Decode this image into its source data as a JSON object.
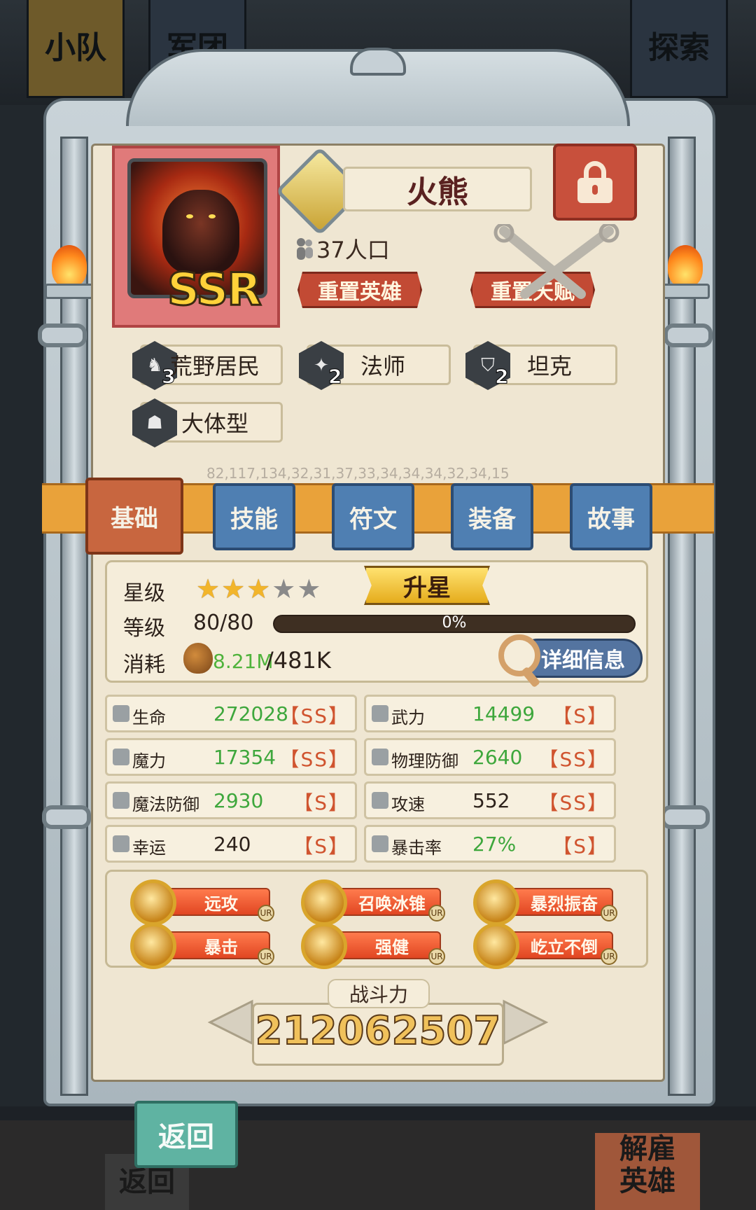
{
  "top_tabs": [
    "小队",
    "军团",
    "探索"
  ],
  "bottom_bg": {
    "left_button": "返回",
    "right_button_line1": "解雇",
    "right_button_line2": "英雄"
  },
  "hero": {
    "rarity": "SSR",
    "name": "火熊",
    "population": "37人口",
    "reset_hero": "重置英雄",
    "reset_talent": "重置天赋"
  },
  "traits": [
    {
      "label": "荒野居民",
      "count": "3",
      "icon": "wild-icon"
    },
    {
      "label": "法师",
      "count": "2",
      "icon": "mage-icon"
    },
    {
      "label": "坦克",
      "count": "2",
      "icon": "shield-icon"
    },
    {
      "label": "大体型",
      "count": "",
      "icon": "large-body-icon"
    }
  ],
  "sequence_text": "82,117,134,32,31,37,33,34,34,34,32,34,15",
  "tabs": [
    "基础",
    "技能",
    "符文",
    "装备",
    "故事"
  ],
  "basic": {
    "star_label": "星级",
    "stars_filled": 3,
    "stars_total": 5,
    "upstar": "升星",
    "level_label": "等级",
    "level": "80/80",
    "progress_text": "0%",
    "progress_fraction": 0.0,
    "cost_label": "消耗",
    "cost_have": "8.21M",
    "cost_need": "/481K",
    "detail": "详细信息"
  },
  "attributes": [
    {
      "name": "生命",
      "value": "272028",
      "grade": "【SS】",
      "value_color": "green"
    },
    {
      "name": "武力",
      "value": "14499",
      "grade": "【S】",
      "value_color": "green"
    },
    {
      "name": "魔力",
      "value": "17354",
      "grade": "【SS】",
      "value_color": "green"
    },
    {
      "name": "物理防御",
      "value": "2640",
      "grade": "【SS】",
      "value_color": "green"
    },
    {
      "name": "魔法防御",
      "value": "2930",
      "grade": "【S】",
      "value_color": "green"
    },
    {
      "name": "攻速",
      "value": "552",
      "grade": "【SS】",
      "value_color": "dark"
    },
    {
      "name": "幸运",
      "value": "240",
      "grade": "【S】",
      "value_color": "dark"
    },
    {
      "name": "暴击率",
      "value": "27%",
      "grade": "【S】",
      "value_color": "green"
    }
  ],
  "skills": [
    {
      "name": "远攻",
      "badge": "UR"
    },
    {
      "name": "召唤冰锥",
      "badge": "UR"
    },
    {
      "name": "暴烈振奋",
      "badge": "UR"
    },
    {
      "name": "暴击",
      "badge": "UR"
    },
    {
      "name": "强健",
      "badge": "UR"
    },
    {
      "name": "屹立不倒",
      "badge": "UR"
    }
  ],
  "power": {
    "label": "战斗力",
    "value": "212062507"
  },
  "back": "返回",
  "colors": {
    "accent_gold": "#e9a23a",
    "tab_blue": "#4f7fb2",
    "tab_active": "#c8663f",
    "green_value": "#3ea73c",
    "grade_red": "#d0542f"
  }
}
